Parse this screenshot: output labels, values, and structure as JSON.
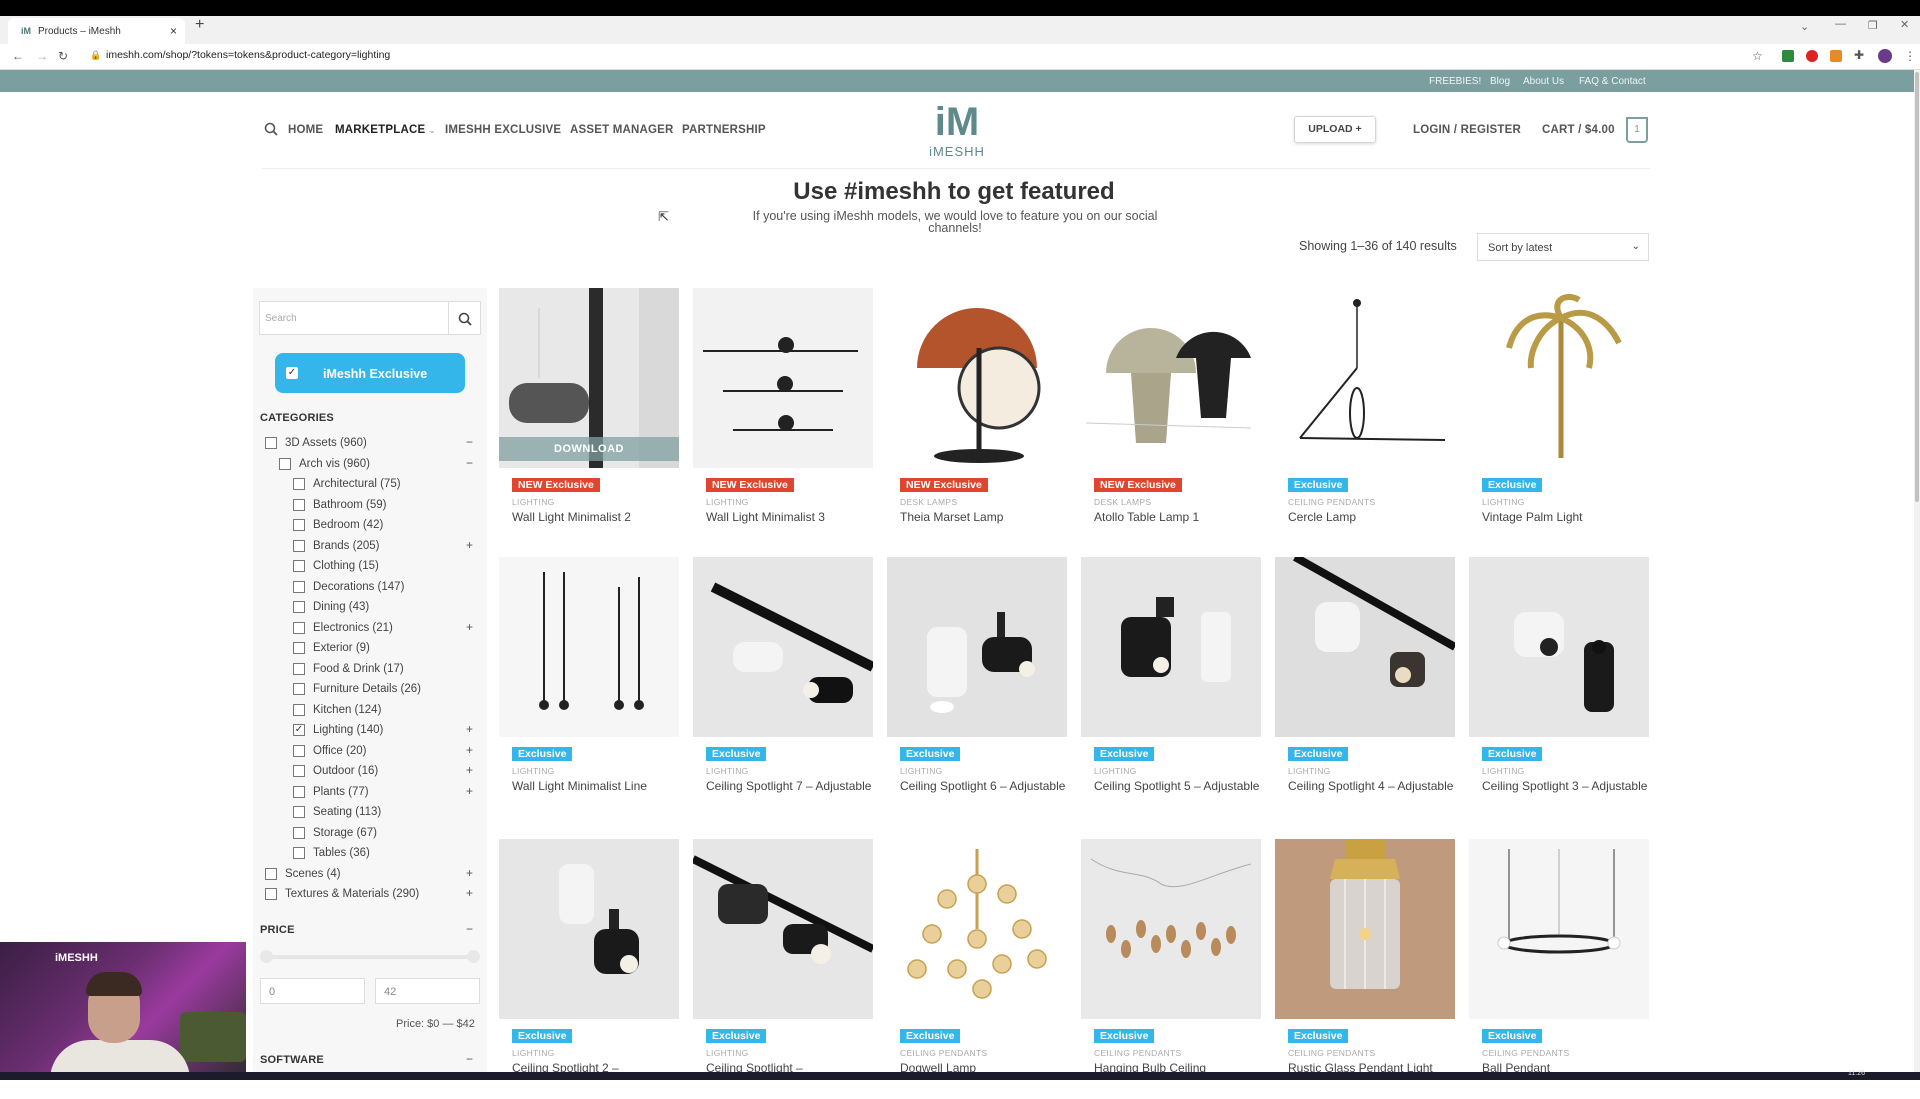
{
  "browser": {
    "tab_title": "Products – iMeshh",
    "tab_favicon": "iM",
    "url": "imeshh.com/shop/?tokens=tokens&product-category=lighting"
  },
  "utility_links": [
    "FREEBIES!",
    "Blog",
    "About Us",
    "FAQ & Contact"
  ],
  "header": {
    "nav": [
      "HOME",
      "MARKETPLACE",
      "IMESHH EXCLUSIVE",
      "ASSET MANAGER",
      "PARTNERSHIP"
    ],
    "logo_mark": "iM",
    "logo_word": "iMESHH",
    "upload_label": "UPLOAD +",
    "login_label": "LOGIN / REGISTER",
    "cart_label": "CART / $4.00",
    "cart_count": "1"
  },
  "promo": {
    "title": "Use #imeshh to get featured",
    "subtitle": "If you're using iMeshh models, we would love to feature you on our social channels!"
  },
  "results": {
    "count_text": "Showing 1–36 of 140 results",
    "sort_selected": "Sort by latest"
  },
  "sidebar": {
    "search_placeholder": "Search",
    "exclusive_label": "iMeshh Exclusive",
    "categories_heading": "CATEGORIES",
    "categories": [
      {
        "label": "3D Assets (960)",
        "checked": false,
        "toggle": "−"
      },
      {
        "label": "Arch vis (960)",
        "checked": false,
        "toggle": "−"
      },
      {
        "label": "Architectural (75)",
        "checked": false,
        "toggle": ""
      },
      {
        "label": "Bathroom (59)",
        "checked": false,
        "toggle": ""
      },
      {
        "label": "Bedroom (42)",
        "checked": false,
        "toggle": ""
      },
      {
        "label": "Brands (205)",
        "checked": false,
        "toggle": "+"
      },
      {
        "label": "Clothing (15)",
        "checked": false,
        "toggle": ""
      },
      {
        "label": "Decorations (147)",
        "checked": false,
        "toggle": ""
      },
      {
        "label": "Dining (43)",
        "checked": false,
        "toggle": ""
      },
      {
        "label": "Electronics (21)",
        "checked": false,
        "toggle": "+"
      },
      {
        "label": "Exterior (9)",
        "checked": false,
        "toggle": ""
      },
      {
        "label": "Food & Drink (17)",
        "checked": false,
        "toggle": ""
      },
      {
        "label": "Furniture Details (26)",
        "checked": false,
        "toggle": ""
      },
      {
        "label": "Kitchen (124)",
        "checked": false,
        "toggle": ""
      },
      {
        "label": "Lighting (140)",
        "checked": true,
        "toggle": "+"
      },
      {
        "label": "Office (20)",
        "checked": false,
        "toggle": "+"
      },
      {
        "label": "Outdoor (16)",
        "checked": false,
        "toggle": "+"
      },
      {
        "label": "Plants (77)",
        "checked": false,
        "toggle": "+"
      },
      {
        "label": "Seating (113)",
        "checked": false,
        "toggle": ""
      },
      {
        "label": "Storage (67)",
        "checked": false,
        "toggle": ""
      },
      {
        "label": "Tables (36)",
        "checked": false,
        "toggle": ""
      },
      {
        "label": "Scenes (4)",
        "checked": false,
        "toggle": "+"
      },
      {
        "label": "Textures & Materials (290)",
        "checked": false,
        "toggle": "+"
      }
    ],
    "price_heading": "PRICE",
    "price_toggle": "−",
    "price_min": "0",
    "price_max": "42",
    "price_label": "Price: $0 — $42",
    "software_heading": "SOFTWARE",
    "software_toggle": "−"
  },
  "products": [
    {
      "badge": "NEW Exclusive",
      "badge_type": "new",
      "category": "LIGHTING",
      "name": "Wall Light Minimalist 2",
      "overlay": "DOWNLOAD"
    },
    {
      "badge": "NEW Exclusive",
      "badge_type": "new",
      "category": "LIGHTING",
      "name": "Wall Light Minimalist 3"
    },
    {
      "badge": "NEW Exclusive",
      "badge_type": "new",
      "category": "DESK LAMPS",
      "name": "Theia Marset Lamp"
    },
    {
      "badge": "NEW Exclusive",
      "badge_type": "new",
      "category": "DESK LAMPS",
      "name": "Atollo Table Lamp 1"
    },
    {
      "badge": "Exclusive",
      "badge_type": "excl",
      "category": "CEILING PENDANTS",
      "name": "Cercle Lamp"
    },
    {
      "badge": "Exclusive",
      "badge_type": "excl",
      "category": "LIGHTING",
      "name": "Vintage Palm Light"
    },
    {
      "badge": "Exclusive",
      "badge_type": "excl",
      "category": "LIGHTING",
      "name": "Wall Light Minimalist Line"
    },
    {
      "badge": "Exclusive",
      "badge_type": "excl",
      "category": "LIGHTING",
      "name": "Ceiling Spotlight 7 – Adjustable"
    },
    {
      "badge": "Exclusive",
      "badge_type": "excl",
      "category": "LIGHTING",
      "name": "Ceiling Spotlight 6 – Adjustable"
    },
    {
      "badge": "Exclusive",
      "badge_type": "excl",
      "category": "LIGHTING",
      "name": "Ceiling Spotlight 5 – Adjustable"
    },
    {
      "badge": "Exclusive",
      "badge_type": "excl",
      "category": "LIGHTING",
      "name": "Ceiling Spotlight 4 – Adjustable"
    },
    {
      "badge": "Exclusive",
      "badge_type": "excl",
      "category": "LIGHTING",
      "name": "Ceiling Spotlight 3 – Adjustable"
    },
    {
      "badge": "Exclusive",
      "badge_type": "excl",
      "category": "LIGHTING",
      "name": "Ceiling Spotlight 2 –"
    },
    {
      "badge": "Exclusive",
      "badge_type": "excl",
      "category": "LIGHTING",
      "name": "Ceiling Spotlight –"
    },
    {
      "badge": "Exclusive",
      "badge_type": "excl",
      "category": "CEILING PENDANTS",
      "name": "Dogwell Lamp"
    },
    {
      "badge": "Exclusive",
      "badge_type": "excl",
      "category": "CEILING PENDANTS",
      "name": "Hanging Bulb Ceiling"
    },
    {
      "badge": "Exclusive",
      "badge_type": "excl",
      "category": "CEILING PENDANTS",
      "name": "Rustic Glass Pendant Light"
    },
    {
      "badge": "Exclusive",
      "badge_type": "excl",
      "category": "CEILING PENDANTS",
      "name": "Ball Pendant"
    }
  ],
  "webcam": {
    "logo": "iMESHH"
  },
  "taskbar": {
    "clock": "11:26"
  }
}
